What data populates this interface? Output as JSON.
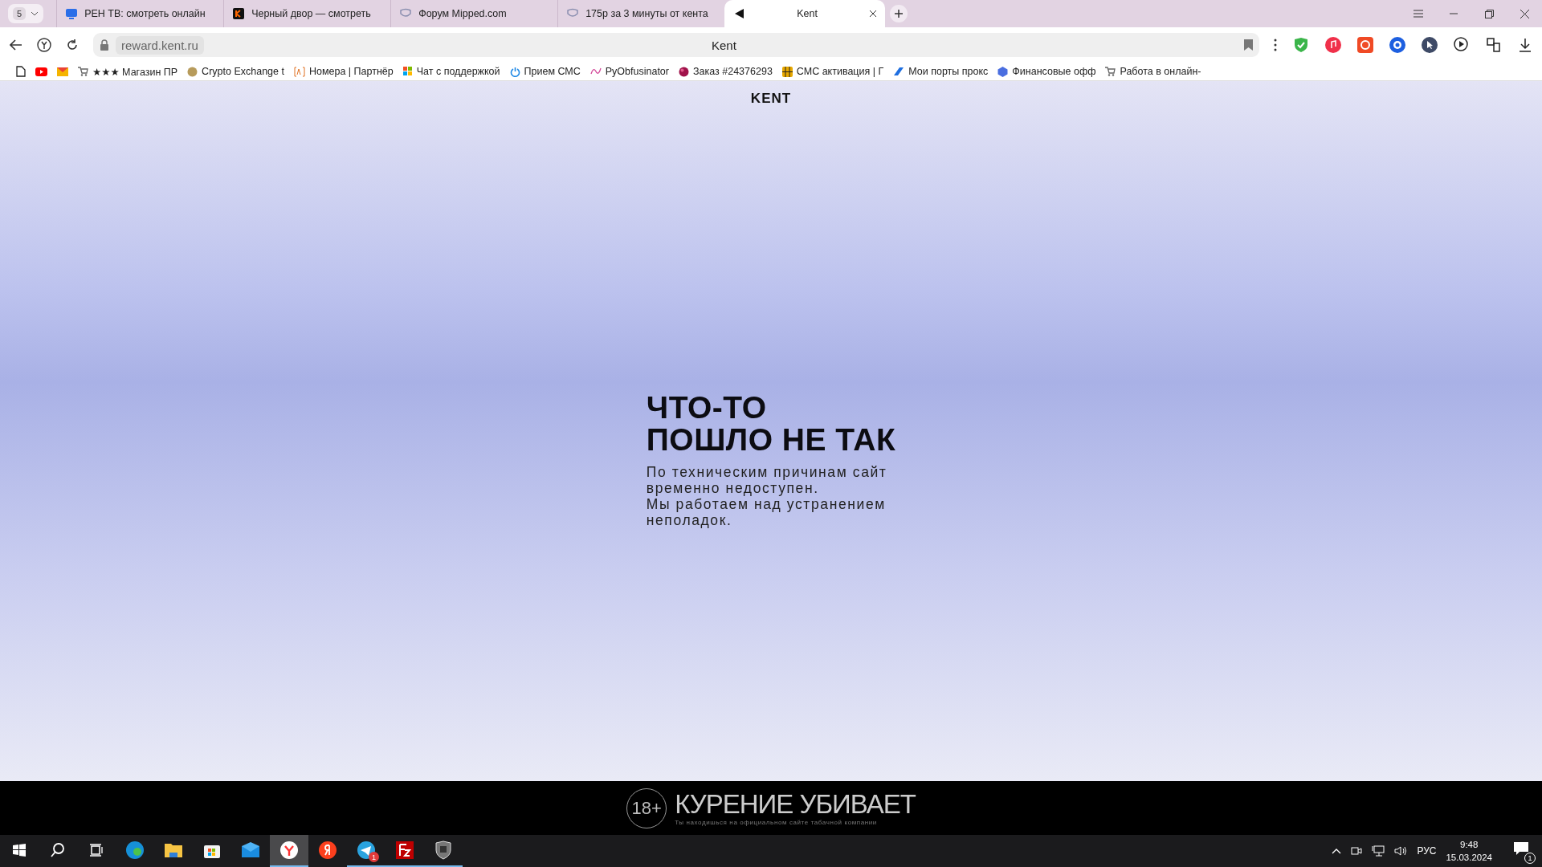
{
  "browser": {
    "tab_count": "5",
    "tabs": [
      {
        "title": "РЕН ТВ: смотреть онлайн",
        "kind": "tv",
        "selected": false
      },
      {
        "title": "Черный двор — смотреть",
        "kind": "orange",
        "selected": false
      },
      {
        "title": "Форум Mipped.com",
        "kind": "mask",
        "selected": false
      },
      {
        "title": "175р за 3 минуты от кента",
        "kind": "mask",
        "selected": false
      },
      {
        "title": "Kent",
        "kind": "kent",
        "selected": true
      }
    ],
    "address": "reward.kent.ru",
    "page_title": "Kent",
    "bookmarks": [
      {
        "kind": "page"
      },
      {
        "kind": "youtube"
      },
      {
        "kind": "mail"
      },
      {
        "title": "★★★ Магазин ПР",
        "kind": "cart"
      },
      {
        "title": "Crypto Exchange t",
        "kind": "coin"
      },
      {
        "title": "Номера | Партнёр",
        "kind": "ac"
      },
      {
        "title": "Чат с поддержкой",
        "kind": "grid"
      },
      {
        "title": "Прием СМС",
        "kind": "power"
      },
      {
        "title": "PyObfusinator",
        "kind": "script"
      },
      {
        "title": "Заказ #24376293",
        "kind": "ball"
      },
      {
        "title": "СМС активация | Г",
        "kind": "chip"
      },
      {
        "title": "Мои порты прокс",
        "kind": "k"
      },
      {
        "title": "Финансовые офф",
        "kind": "cube"
      },
      {
        "title": "Работа в онлайн-",
        "kind": "cart"
      }
    ]
  },
  "page": {
    "logo": "KENT",
    "heading": [
      "ЧТО-ТО",
      "ПОШЛО НЕ ТАК"
    ],
    "message": [
      "По техническим причинам сайт",
      "временно недоступен.",
      "Мы работаем над устранением",
      "неполадок."
    ],
    "warning": {
      "age": "18+",
      "title": "КУРЕНИЕ УБИВАЕТ",
      "subtitle": "Ты находишься на официальном сайте табачной компании"
    }
  },
  "taskbar": {
    "apps": [
      {
        "kind": "edge",
        "running": false,
        "selected": false
      },
      {
        "kind": "explorer",
        "running": false,
        "selected": false
      },
      {
        "kind": "store",
        "running": false,
        "selected": false
      },
      {
        "kind": "mail",
        "running": false,
        "selected": false
      },
      {
        "kind": "ybrowser",
        "running": true,
        "selected": true
      },
      {
        "kind": "yandex",
        "running": false,
        "selected": false
      },
      {
        "kind": "telegram",
        "running": true,
        "selected": false,
        "badge": "1"
      },
      {
        "kind": "filezilla",
        "running": true,
        "selected": false
      },
      {
        "kind": "tanks",
        "running": true,
        "selected": false
      }
    ],
    "language": "РУС",
    "time": "9:48",
    "date": "15.03.2024",
    "notifications": "1"
  }
}
